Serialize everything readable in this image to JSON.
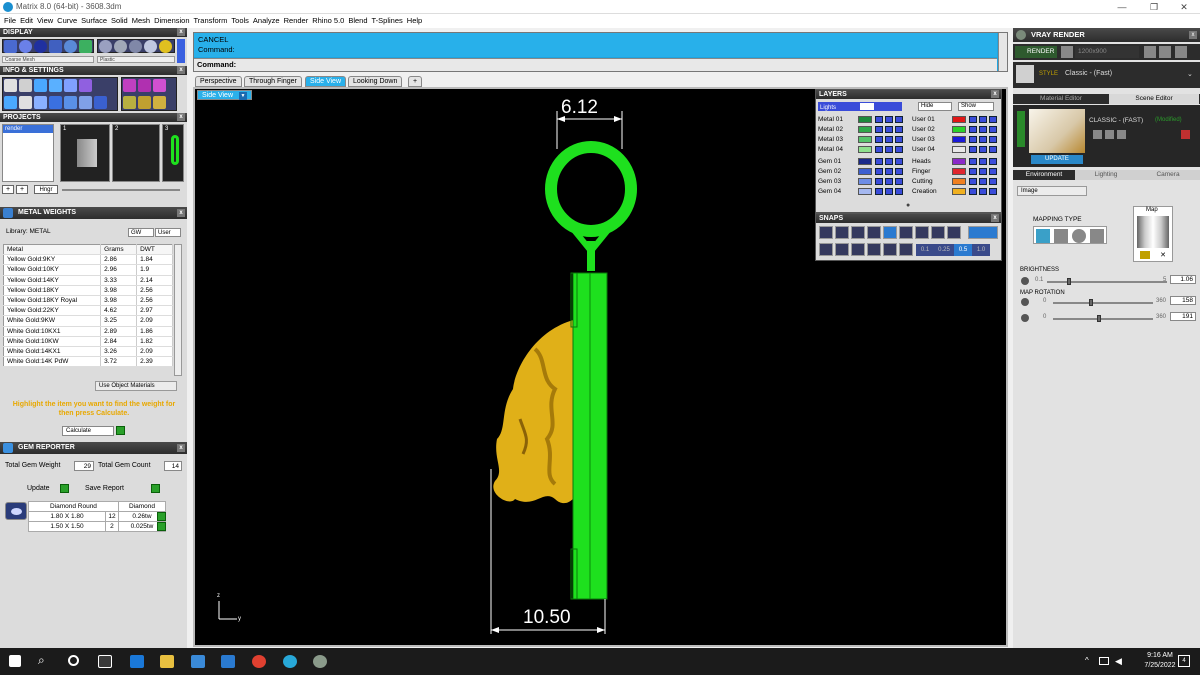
{
  "window": {
    "title": "Matrix 8.0 (64-bit) - 3608.3dm",
    "minimize": "—",
    "maximize": "❐",
    "close": "✕"
  },
  "menu": [
    "File",
    "Edit",
    "View",
    "Curve",
    "Surface",
    "Solid",
    "Mesh",
    "Dimension",
    "Transform",
    "Tools",
    "Analyze",
    "Render",
    "Rhino 5.0",
    "Blend",
    "T-Splines",
    "Help"
  ],
  "display": {
    "title": "DISPLAY",
    "left_dropdown": "Coarse Mesh",
    "right_dropdown": "Plastic"
  },
  "info": {
    "title": "INFO & SETTINGS"
  },
  "projects": {
    "title": "PROJECTS",
    "item": "render",
    "slot1": "1",
    "slot2": "2",
    "slot3": "3",
    "hngr": "Hngr"
  },
  "metal_weights": {
    "title": "METAL WEIGHTS",
    "library_label": "Library: METAL",
    "gw_label": "GW",
    "user_label": "User",
    "headers": [
      "Metal",
      "Grams",
      "DWT"
    ],
    "rows": [
      [
        "Yellow Gold:9KY",
        "2.86",
        "1.84"
      ],
      [
        "Yellow Gold:10KY",
        "2.96",
        "1.9"
      ],
      [
        "Yellow Gold:14KY",
        "3.33",
        "2.14"
      ],
      [
        "Yellow Gold:18KY",
        "3.98",
        "2.56"
      ],
      [
        "Yellow Gold:18KY Royal",
        "3.98",
        "2.56"
      ],
      [
        "Yellow Gold:22KY",
        "4.62",
        "2.97"
      ],
      [
        "White Gold:9KW",
        "3.25",
        "2.09"
      ],
      [
        "White Gold:10KX1",
        "2.89",
        "1.86"
      ],
      [
        "White Gold:10KW",
        "2.84",
        "1.82"
      ],
      [
        "White Gold:14KX1",
        "3.26",
        "2.09"
      ],
      [
        "White Gold:14K PdW",
        "3.72",
        "2.39"
      ]
    ],
    "use_object_materials": "Use Object Materials",
    "hint": "Highlight the item you want to find the weight for then press Calculate.",
    "calculate": "Calculate"
  },
  "gem_reporter": {
    "title": "GEM REPORTER",
    "total_weight_label": "Total Gem Weight",
    "total_weight": "29",
    "total_count_label": "Total Gem Count",
    "total_count": "14",
    "update": "Update",
    "save_report": "Save Report",
    "headers": [
      "Diamond Round",
      "Diamond"
    ],
    "rows": [
      [
        "1.80 X 1.80",
        "12",
        "0.26tw"
      ],
      [
        "1.50 X 1.50",
        "2",
        "0.025tw"
      ]
    ]
  },
  "command": {
    "cancel": "CANCEL",
    "prompt1": "Command:",
    "prompt2": "Command:"
  },
  "viewport_tabs": [
    "Perspective",
    "Through Finger",
    "Side View",
    "Looking Down",
    "+"
  ],
  "active_view": "Side View",
  "dimensions": {
    "top": "6.12",
    "bottom": "10.50"
  },
  "axes": {
    "z": "z",
    "y": "y"
  },
  "layers": {
    "title": "LAYERS",
    "lights": "Lights",
    "hide": "Hide",
    "show": "Show",
    "left_rows": [
      {
        "label": "Metal 01",
        "color": "#1c8a3c"
      },
      {
        "label": "Metal 02",
        "color": "#2fa84a"
      },
      {
        "label": "Metal 03",
        "color": "#55c46b"
      },
      {
        "label": "Metal 04",
        "color": "#8ee08e"
      },
      {
        "label": "Gem 01",
        "color": "#1a2a8a"
      },
      {
        "label": "Gem 02",
        "color": "#3c5fd0"
      },
      {
        "label": "Gem 03",
        "color": "#6d8de6"
      },
      {
        "label": "Gem 04",
        "color": "#a5b8f0"
      }
    ],
    "right_rows": [
      {
        "label": "User 01",
        "color": "#e01616"
      },
      {
        "label": "User 02",
        "color": "#2ad02a"
      },
      {
        "label": "User 03",
        "color": "#1a1ad8"
      },
      {
        "label": "User 04",
        "color": "#e8e8e8"
      },
      {
        "label": "Heads",
        "color": "#8a2ac8"
      },
      {
        "label": "Finger",
        "color": "#e0262e"
      },
      {
        "label": "Cutting",
        "color": "#f08020"
      },
      {
        "label": "Creation",
        "color": "#f0b020"
      }
    ]
  },
  "snaps": {
    "title": "SNAPS",
    "vals": [
      "0.1",
      "0.25",
      "0.5",
      "1.0"
    ]
  },
  "vray": {
    "title": "VRAY RENDER",
    "render_btn": "RENDER",
    "resolution": "1200x900",
    "style_label": "STYLE",
    "style_value": "Classic - (Fast)",
    "tabs": [
      "Material Editor",
      "Scene Editor"
    ],
    "preset": "CLASSIC - (FAST)",
    "modified": "(Modified)",
    "update": "UPDATE",
    "env_tabs": [
      "Environment",
      "Lighting",
      "Camera"
    ],
    "env_type": "Image",
    "map_label": "Map",
    "mapping_type": "MAPPING TYPE",
    "brightness": {
      "label": "BRIGHTNESS",
      "min": "0.1",
      "max": "5",
      "value": "1.06"
    },
    "map_rotation": {
      "label": "MAP ROTATION",
      "min": "0",
      "max": "360",
      "value1": "158",
      "value2": "191"
    }
  },
  "taskbar": {
    "time": "9:16 AM",
    "date": "7/25/2022",
    "notif": "4"
  },
  "colors": {
    "accent": "#1ea4e0",
    "model_green": "#1ee01e",
    "gold": "#e0b018"
  }
}
